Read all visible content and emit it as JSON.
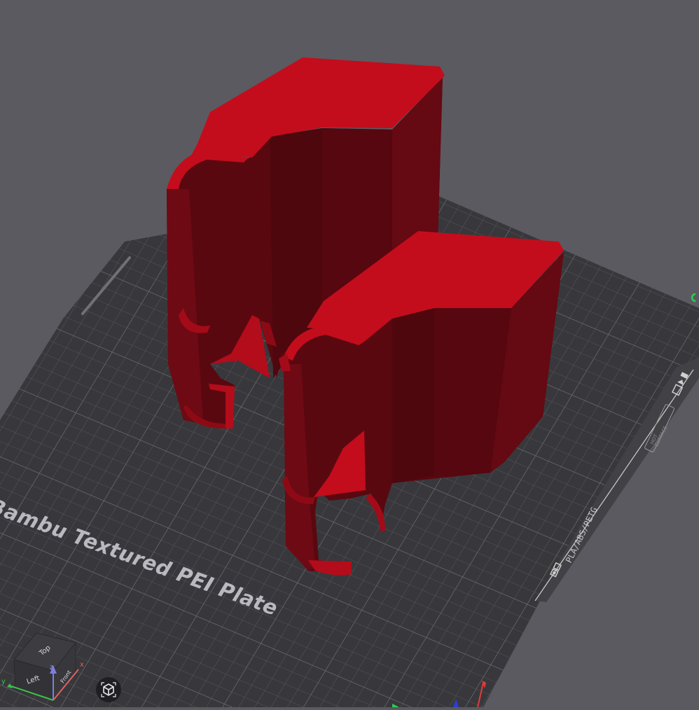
{
  "plate": {
    "name": "Bambu Textured PEI Plate",
    "filament_label": "PLA/ABS/PETG",
    "hot_label_line1": "HOT",
    "hot_label_line2": "SURFACE"
  },
  "view_cube": {
    "face_top": "Top",
    "face_left": "Left",
    "face_front": "Front",
    "axis_x": "x",
    "axis_y": "y",
    "axis_z": "z"
  },
  "colors": {
    "background": "#5b5a60",
    "plate": "#38383c",
    "model": "#c30d1c",
    "axis_x": "#e23b3b",
    "axis_y": "#3fbf4a",
    "axis_z": "#7d7ed8"
  },
  "icons": {
    "reset_view": "view-cube-reset-icon",
    "plate_badge": "plate-type-badge-icon"
  }
}
